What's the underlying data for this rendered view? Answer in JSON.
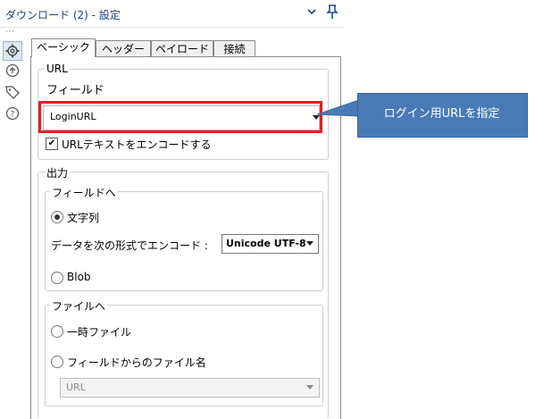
{
  "window": {
    "title": "ダウンロード (2) - 設定"
  },
  "tabs": [
    {
      "label": "ベーシック",
      "active": true
    },
    {
      "label": "ヘッダー",
      "active": false
    },
    {
      "label": "ペイロード",
      "active": false
    },
    {
      "label": "接続",
      "active": false
    }
  ],
  "url_group": {
    "label": "URL",
    "field_label": "フィールド",
    "field_value": "LoginURL",
    "encode_checkbox_label": "URLテキストをエンコードする",
    "encode_checked": true
  },
  "output": {
    "label": "出力",
    "to_field": {
      "label": "フィールドへ",
      "string_option": "文字列",
      "string_selected": true,
      "encode_label": "データを次の形式でエンコード :",
      "encode_value": "Unicode UTF-8",
      "blob_option": "Blob",
      "blob_selected": false
    },
    "to_file": {
      "label": "ファイルへ",
      "temp_option": "一時ファイル",
      "temp_selected": false,
      "from_field_option": "フィールドからのファイル名",
      "from_field_selected": false,
      "field_placeholder": "URL"
    }
  },
  "callout": {
    "text": "ログイン用URLを指定"
  },
  "colors": {
    "highlight": "#e02020",
    "callout_bg": "#4a7ab5",
    "title_text": "#1f3f6f"
  },
  "icons": [
    "chevron-down-icon",
    "pin-icon",
    "gear-icon",
    "arrow-circle-icon",
    "tag-icon",
    "help-icon"
  ]
}
